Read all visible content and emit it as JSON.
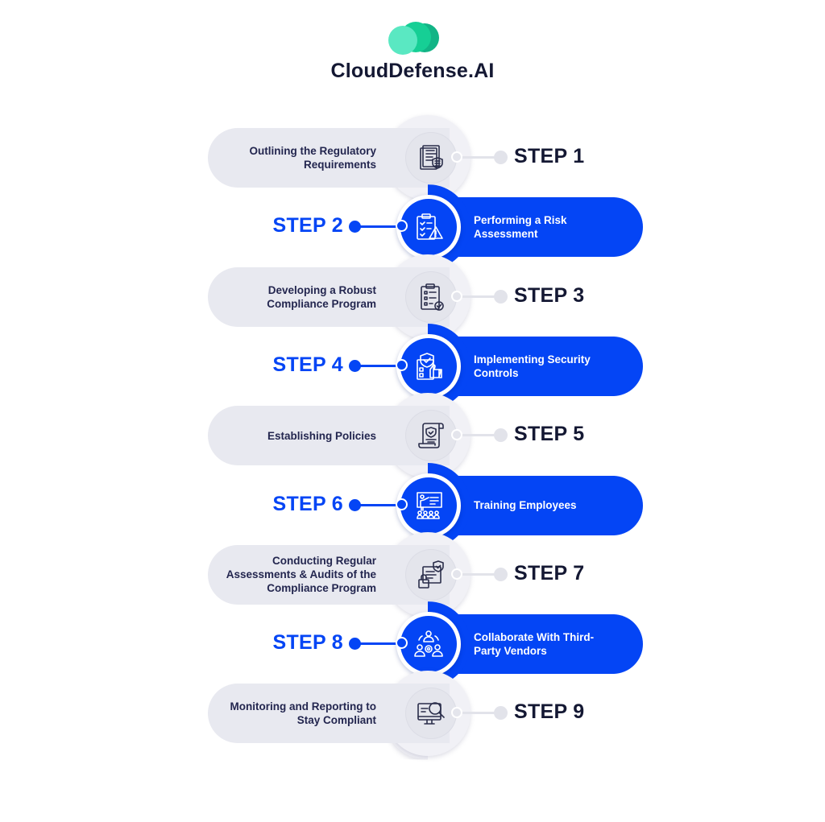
{
  "brand": {
    "name": "CloudDefense.AI",
    "colors": {
      "cloud_light": "#5ae8c2",
      "cloud_mid": "#16cf95",
      "cloud_dark": "#12b486",
      "text": "#141833"
    }
  },
  "theme": {
    "blue": "#0445f5",
    "gray_pill": "#e8e9f0",
    "dark_text": "#141833",
    "gray_text": "#23264f"
  },
  "steps": [
    {
      "label": "STEP 1",
      "title": "Outlining the Regulatory Requirements",
      "lines": [
        "Outlining the Regulatory",
        "Requirements"
      ],
      "style": "gray",
      "icon": "documents-shield-icon"
    },
    {
      "label": "STEP 2",
      "title": "Performing a Risk Assessment",
      "lines": [
        "Performing a Risk",
        "Assessment"
      ],
      "style": "blue",
      "icon": "clipboard-warning-icon"
    },
    {
      "label": "STEP 3",
      "title": "Developing a Robust Compliance Program",
      "lines": [
        "Developing a Robust",
        "Compliance Program"
      ],
      "style": "gray",
      "icon": "clipboard-check-icon"
    },
    {
      "label": "STEP 4",
      "title": "Implementing Security Controls",
      "lines": [
        "Implementing Security",
        "Controls"
      ],
      "style": "blue",
      "icon": "shield-thumbs-up-icon"
    },
    {
      "label": "STEP 5",
      "title": "Establishing Policies",
      "lines": [
        "Establishing Policies"
      ],
      "style": "gray",
      "icon": "policy-scroll-icon"
    },
    {
      "label": "STEP 6",
      "title": "Training Employees",
      "lines": [
        "Training Employees"
      ],
      "style": "blue",
      "icon": "presentation-training-icon"
    },
    {
      "label": "STEP 7",
      "title": "Conducting Regular Assessments & Audits of the Compliance Program",
      "lines": [
        "Conducting Regular",
        "Assessments & Audits of the",
        "Compliance Program"
      ],
      "style": "gray",
      "icon": "document-lock-shield-icon"
    },
    {
      "label": "STEP 8",
      "title": "Collaborate With Third-Party Vendors",
      "lines": [
        "Collaborate With Third-",
        "Party Vendors"
      ],
      "style": "blue",
      "icon": "team-collaboration-icon"
    },
    {
      "label": "STEP 9",
      "title": "Monitoring and Reporting to Stay Compliant",
      "lines": [
        "Monitoring and Reporting to",
        "Stay Compliant"
      ],
      "style": "gray",
      "icon": "monitor-search-icon"
    }
  ]
}
